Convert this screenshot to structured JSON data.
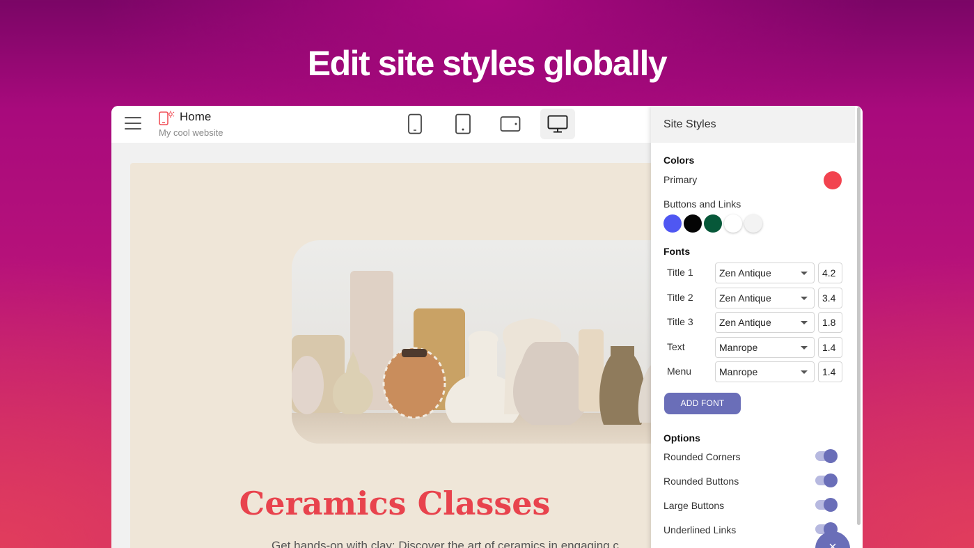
{
  "headline": "Edit site styles globally",
  "header": {
    "site_title": "Home",
    "site_subtitle": "My cool website",
    "devices": [
      {
        "icon": "phone-icon",
        "active": false
      },
      {
        "icon": "tablet-portrait-icon",
        "active": false
      },
      {
        "icon": "tablet-landscape-icon",
        "active": false
      },
      {
        "icon": "desktop-icon",
        "active": true
      }
    ]
  },
  "page": {
    "heading": "Ceramics Classes",
    "text": "Get hands-on with clay: Discover the art of ceramics in engaging c"
  },
  "panel": {
    "title": "Site Styles",
    "colors_title": "Colors",
    "primary_label": "Primary",
    "primary_color": "#f2434f",
    "buttons_links_label": "Buttons and Links",
    "button_colors": [
      "#4f57f2",
      "#050505",
      "#075839",
      "#ffffff",
      "#f3f3f3"
    ],
    "fonts_title": "Fonts",
    "fonts": [
      {
        "name": "Title 1",
        "font": "Zen Antique",
        "size": "4.2"
      },
      {
        "name": "Title 2",
        "font": "Zen Antique",
        "size": "3.4"
      },
      {
        "name": "Title 3",
        "font": "Zen Antique",
        "size": "1.8"
      },
      {
        "name": "Text",
        "font": "Manrope",
        "size": "1.4"
      },
      {
        "name": "Menu",
        "font": "Manrope",
        "size": "1.4"
      }
    ],
    "add_font_label": "ADD FONT",
    "options_title": "Options",
    "options": [
      {
        "label": "Rounded Corners",
        "enabled": true
      },
      {
        "label": "Rounded Buttons",
        "enabled": true
      },
      {
        "label": "Large Buttons",
        "enabled": true
      },
      {
        "label": "Underlined Links",
        "enabled": true
      }
    ],
    "fab_icon": "×"
  },
  "accent_color": "#6a6eb8"
}
